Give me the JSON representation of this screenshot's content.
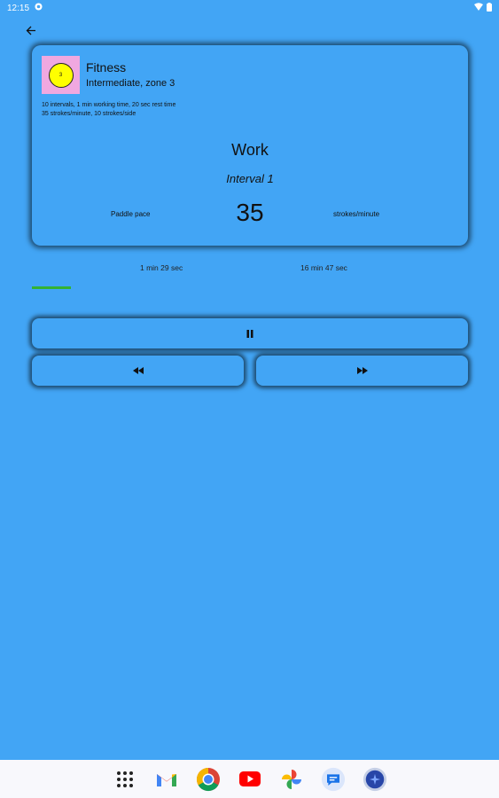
{
  "status_bar": {
    "time": "12:15"
  },
  "workout": {
    "title": "Fitness",
    "subtitle": "Intermediate, zone 3",
    "description_line1": "10 intervals, 1 min working time, 20 sec rest time",
    "description_line2": "35 strokes/minute, 10 strokes/side",
    "zone_number": "3",
    "phase": "Work",
    "interval": "Interval 1",
    "pace_label": "Paddle pace",
    "pace_value": "35",
    "pace_unit": "strokes/minute"
  },
  "timer": {
    "elapsed": "1 min 29 sec",
    "remaining": "16 min 47 sec",
    "progress_fraction": 0.09,
    "progress_color": "#33b233"
  },
  "controls": {
    "pause_icon": "pause-icon",
    "previous_icon": "rewind-icon",
    "next_icon": "fast-forward-icon"
  },
  "dock_apps": [
    "app-drawer-icon",
    "gmail-icon",
    "chrome-icon",
    "youtube-icon",
    "photos-icon",
    "messages-icon",
    "assistant-icon"
  ],
  "colors": {
    "background": "#42a5f5",
    "avatar_bg": "#f0a8e0",
    "zone_circle": "#ffff00"
  }
}
